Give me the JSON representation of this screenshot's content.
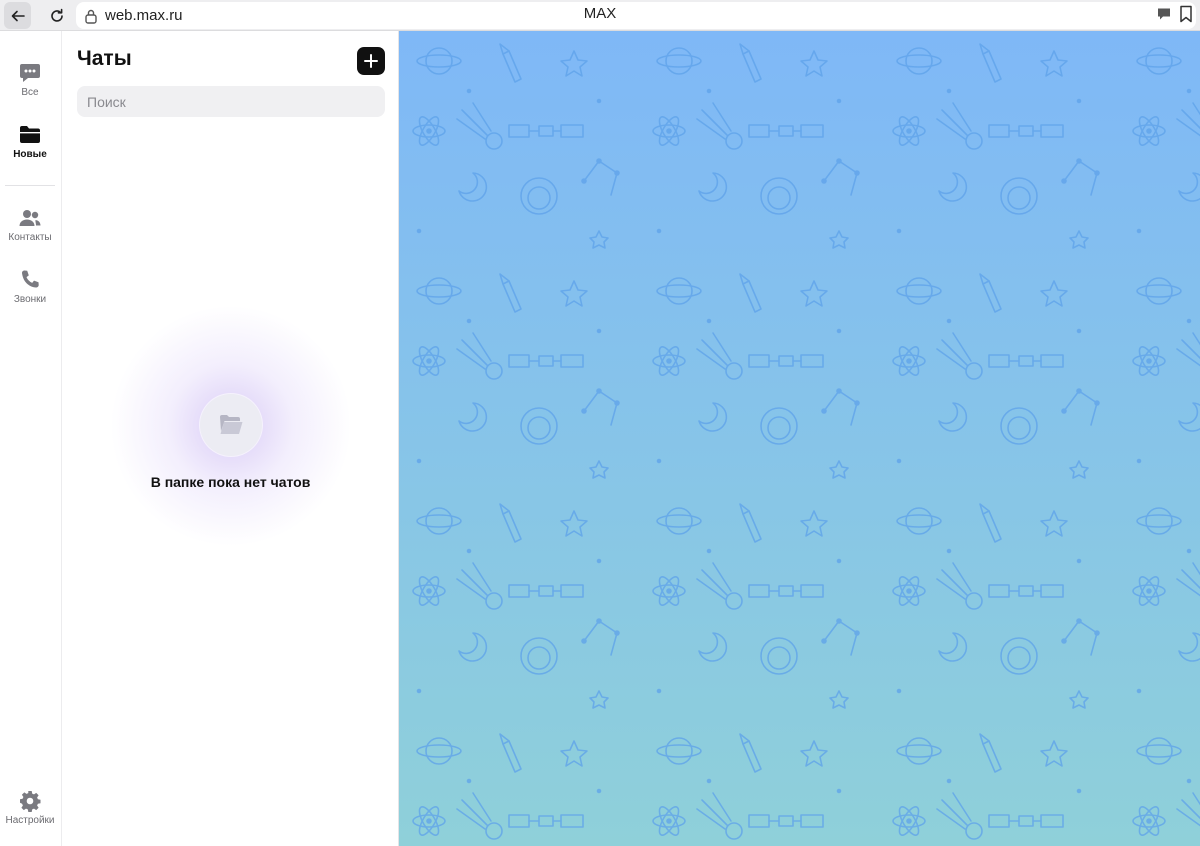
{
  "browser": {
    "url": "web.max.ru",
    "title": "MAX",
    "icons": [
      "back-arrow-icon",
      "reload-icon",
      "lock-icon",
      "chat-bubble-icon",
      "bookmark-icon"
    ]
  },
  "rail": {
    "items": [
      {
        "label": "Все",
        "icon": "chat-bubble-icon",
        "active": false
      },
      {
        "label": "Новые",
        "icon": "folder-icon",
        "active": true
      },
      {
        "label": "Контакты",
        "icon": "contacts-icon",
        "active": false
      },
      {
        "label": "Звонки",
        "icon": "phone-icon",
        "active": false
      }
    ],
    "settings_label": "Настройки"
  },
  "chats": {
    "title": "Чаты",
    "search_placeholder": "Поиск",
    "empty_text": "В папке пока нет чатов",
    "empty_icon": "open-folder-icon"
  },
  "colors": {
    "accent": "#111111",
    "wallpaper_top": "#7fb8f7",
    "wallpaper_bottom": "#8fd0d9",
    "pattern": "#5da2ea"
  }
}
